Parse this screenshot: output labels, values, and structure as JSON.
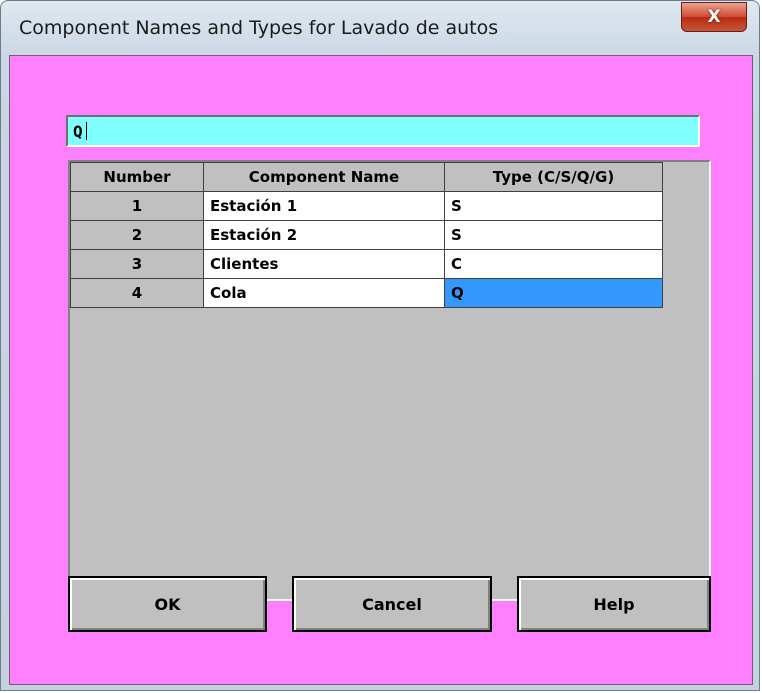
{
  "window": {
    "title": "Component Names and Types for Lavado de autos",
    "close_label": "X"
  },
  "edit": {
    "value": "Q"
  },
  "grid": {
    "headers": [
      "Number",
      "Component Name",
      "Type (C/S/Q/G)"
    ],
    "rows": [
      {
        "number": "1",
        "name": "Estación 1",
        "type": "S"
      },
      {
        "number": "2",
        "name": "Estación 2",
        "type": "S"
      },
      {
        "number": "3",
        "name": "Clientes",
        "type": "C"
      },
      {
        "number": "4",
        "name": "Cola",
        "type": "Q"
      }
    ]
  },
  "buttons": {
    "ok": "OK",
    "cancel": "Cancel",
    "help": "Help"
  },
  "colors": {
    "client_background": "#ff80ff",
    "edit_background": "#80ffff",
    "selection": "#3399ff"
  }
}
